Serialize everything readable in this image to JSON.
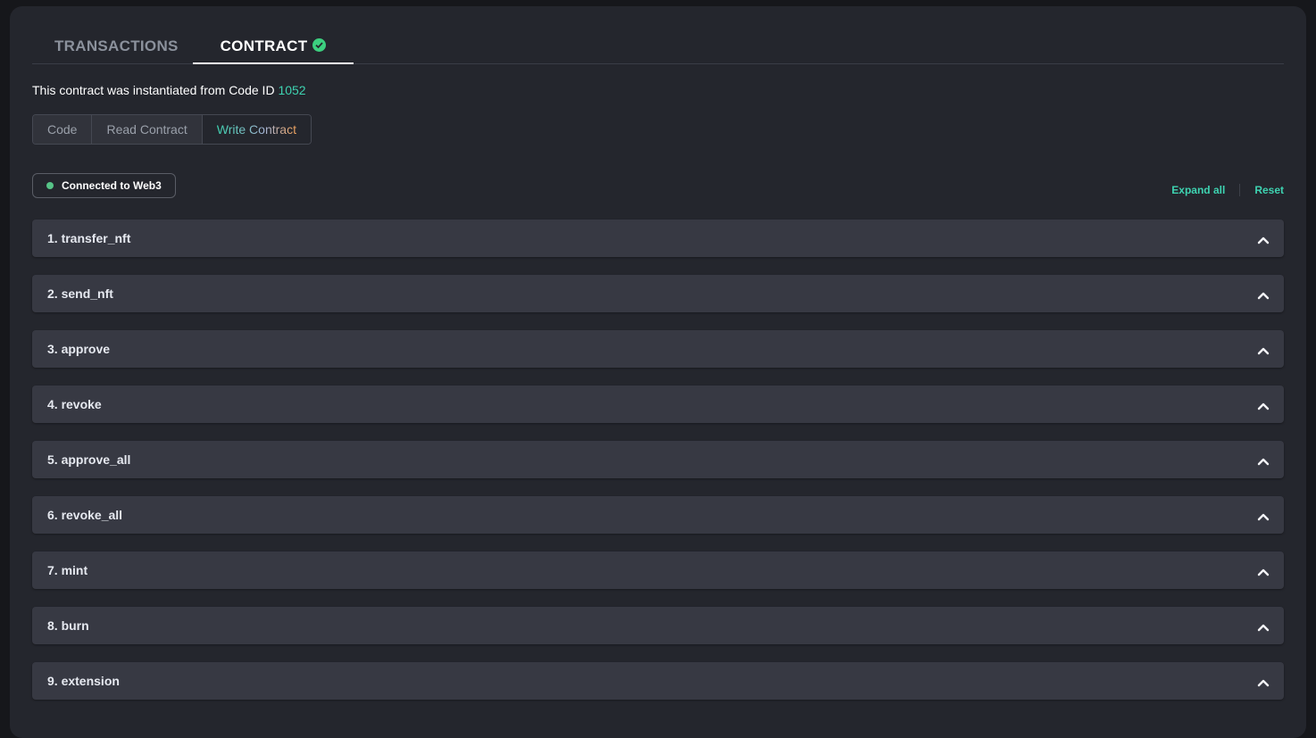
{
  "tabs": [
    {
      "label": "TRANSACTIONS",
      "active": false
    },
    {
      "label": "CONTRACT",
      "active": true,
      "verified": true
    }
  ],
  "intro": {
    "text": "This contract was instantiated from Code ID ",
    "code_id": "1052"
  },
  "segments": [
    "Code",
    "Read Contract",
    "Write Contract"
  ],
  "active_segment": "Write Contract",
  "status": {
    "label": "Connected to Web3",
    "color": "#56c387"
  },
  "actions": {
    "expand_all": "Expand all",
    "reset": "Reset"
  },
  "functions": [
    "1. transfer_nft",
    "2. send_nft",
    "3. approve",
    "4. revoke",
    "5. approve_all",
    "6. revoke_all",
    "7. mint",
    "8. burn",
    "9. extension"
  ],
  "colors": {
    "accent": "#3ed3b1",
    "verified": "#3ccf7f"
  }
}
